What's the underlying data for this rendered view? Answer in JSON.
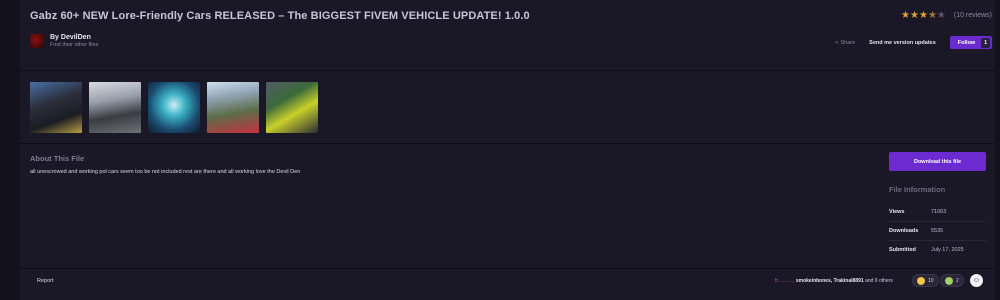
{
  "header": {
    "title": "Gabz 60+ NEW Lore-Friendly Cars RELEASED – The BIGGEST FIVEM VEHICLE UPDATE! 1.0.0",
    "rating_stars": 3.5,
    "reviews_label": "(10 reviews)"
  },
  "author": {
    "name": "By DevilDen",
    "subtitle": "Find their other files"
  },
  "actions": {
    "share_label": "Share",
    "send_version_label": "Send me version updates",
    "follow_label": "Follow",
    "follow_count": "1"
  },
  "gallery": {
    "thumbnails": [
      "vehicle-screenshot-1",
      "vehicle-screenshot-2",
      "vehicle-screenshot-3",
      "vehicle-screenshot-4",
      "vehicle-screenshot-5"
    ]
  },
  "about": {
    "title": "About This File",
    "text": "all unescrowed and working pol cars seem too be not included rest are there and all working love the Devil Den"
  },
  "sidebar": {
    "download_label": "Download this file",
    "file_info_title": "File Information",
    "rows": [
      {
        "key": "Views",
        "value": "71063"
      },
      {
        "key": "Downloads",
        "value": "5535"
      },
      {
        "key": "Submitted",
        "value": "July 17, 2025"
      }
    ]
  },
  "footer": {
    "report_label": "Report",
    "reactors_prefix": "fr...........,",
    "reactors_names": "smokeinbones, Trakinal8891",
    "reactors_suffix": "and 9 others",
    "reaction1_count": "10",
    "reaction2_count": "2"
  },
  "colors": {
    "accent": "#6b2bd1",
    "background": "#1a1726",
    "star": "#e0a23a"
  }
}
